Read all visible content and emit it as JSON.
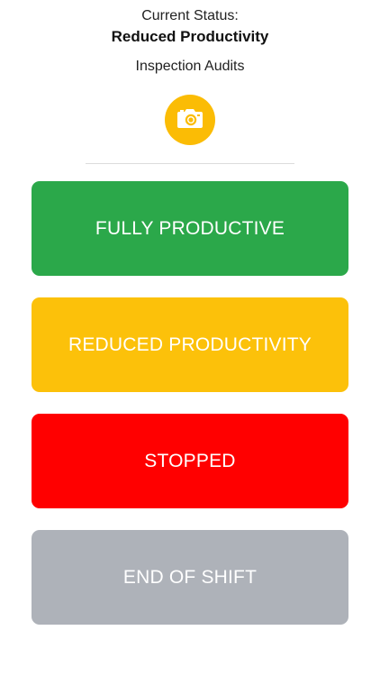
{
  "status": {
    "label": "Current Status:",
    "value": "Reduced Productivity"
  },
  "category": "Inspection Audits",
  "camera": {
    "icon": "camera-icon",
    "color": "#FBBC05"
  },
  "buttons": [
    {
      "label": "FULLY PRODUCTIVE",
      "color": "#2BA84A"
    },
    {
      "label": "REDUCED PRODUCTIVITY",
      "color": "#FCC10A"
    },
    {
      "label": "STOPPED",
      "color": "#FF0000"
    },
    {
      "label": "END OF SHIFT",
      "color": "#AEB2B9"
    }
  ]
}
